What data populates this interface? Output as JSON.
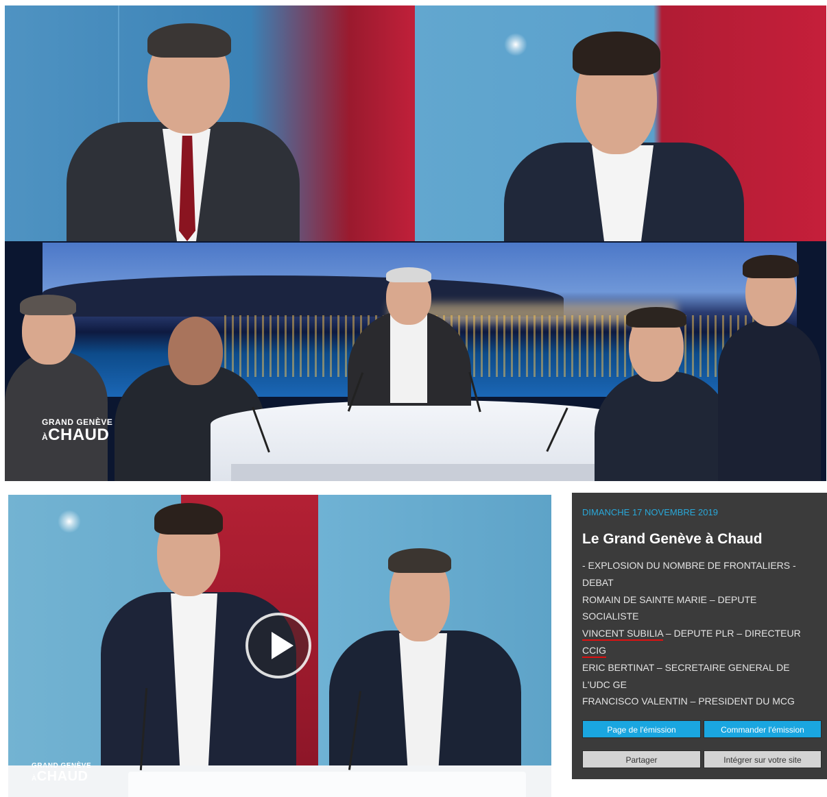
{
  "logo": {
    "line1": "GRAND GENÈVE",
    "line2": "À",
    "line3": "CHAUD"
  },
  "video": {
    "play_icon": "play-icon"
  },
  "info": {
    "date": "DIMANCHE 17 NOVEMBRE 2019",
    "title": "Le Grand Genève à Chaud",
    "lines": [
      "- EXPLOSION DU NOMBRE DE FRONTALIERS -",
      "DEBAT",
      "ROMAIN DE SAINTE MARIE – DEPUTE",
      "SOCIALISTE",
      "VINCENT SUBILIA",
      " – DEPUTE PLR – DIRECTEUR",
      "CCIG",
      "ERIC BERTINAT – SECRETAIRE GENERAL DE",
      "L'UDC GE",
      "FRANCISCO VALENTIN – PRESIDENT DU MCG"
    ],
    "buttons": {
      "page": "Page de l'émission",
      "order": "Commander l'émission",
      "share": "Partager",
      "embed": "Intégrer sur votre site"
    }
  },
  "colors": {
    "accent": "#1aa6e0",
    "panel": "#3b3b3b",
    "underline": "#e01010",
    "date": "#29a8d9"
  }
}
